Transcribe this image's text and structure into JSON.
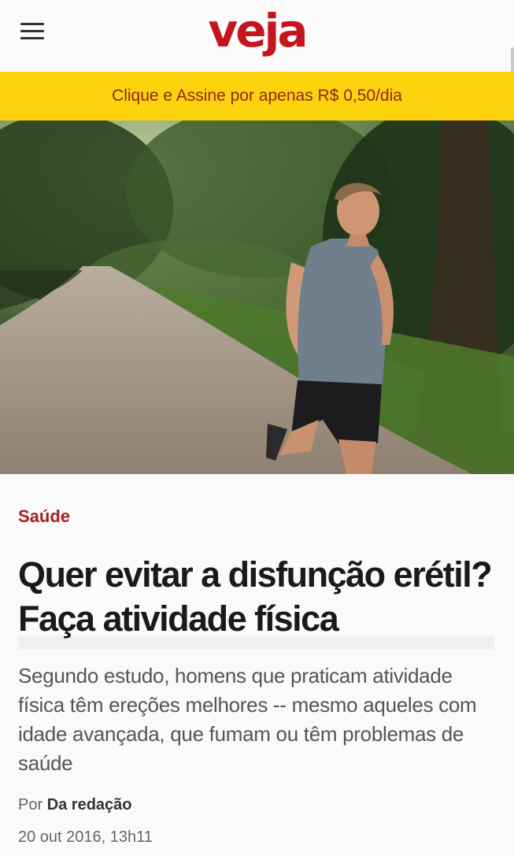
{
  "header": {
    "menu_icon": "hamburger-menu-icon",
    "logo_text": "veja",
    "logo_color": "#c4151c"
  },
  "promo": {
    "text": "Clique e Assine por apenas R$ 0,50/dia",
    "background": "#fdd30d",
    "text_color": "#8a2a15"
  },
  "article": {
    "section": "Saúde",
    "section_color": "#a3211c",
    "headline": "Quer evitar a disfunção erétil? Faça atividade física",
    "subtitle": "Segundo estudo, homens que praticam atividade física têm ereções melhores -- mesmo aqueles com idade avançada, que fumam ou têm problemas de saúde",
    "byline_prefix": "Por",
    "author": "Da redação",
    "date": "20 out 2016, 13h11"
  }
}
